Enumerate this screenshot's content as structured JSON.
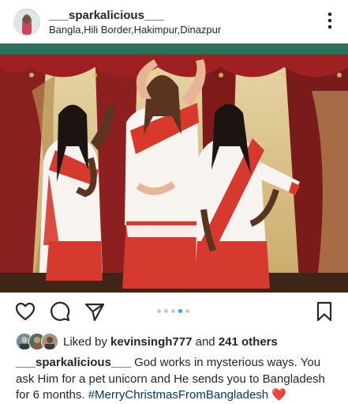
{
  "header": {
    "username": "___sparkalicious___",
    "location": "Bangla,Hili Border,Hakimpur,Dinazpur"
  },
  "carousel": {
    "count": 5,
    "active_index": 3
  },
  "likes": {
    "prefix": "Liked by",
    "user": "kevinsingh777",
    "joiner": "and",
    "others": "241 others"
  },
  "caption": {
    "username": "___sparkalicious___",
    "text": "God works in mysterious ways. You ask Him for a pet unicorn and He sends you to Bangladesh for 6 months.",
    "hashtag": "#MerryChristmasFromBangladesh",
    "emoji": "❤️"
  },
  "icons": [
    "more-vertical-icon",
    "heart-icon",
    "comment-icon",
    "share-icon",
    "bookmark-icon"
  ],
  "colors": {
    "accent": "#3897f0",
    "text": "#262626",
    "hashtag": "#00376b",
    "heart": "#ed4956"
  }
}
